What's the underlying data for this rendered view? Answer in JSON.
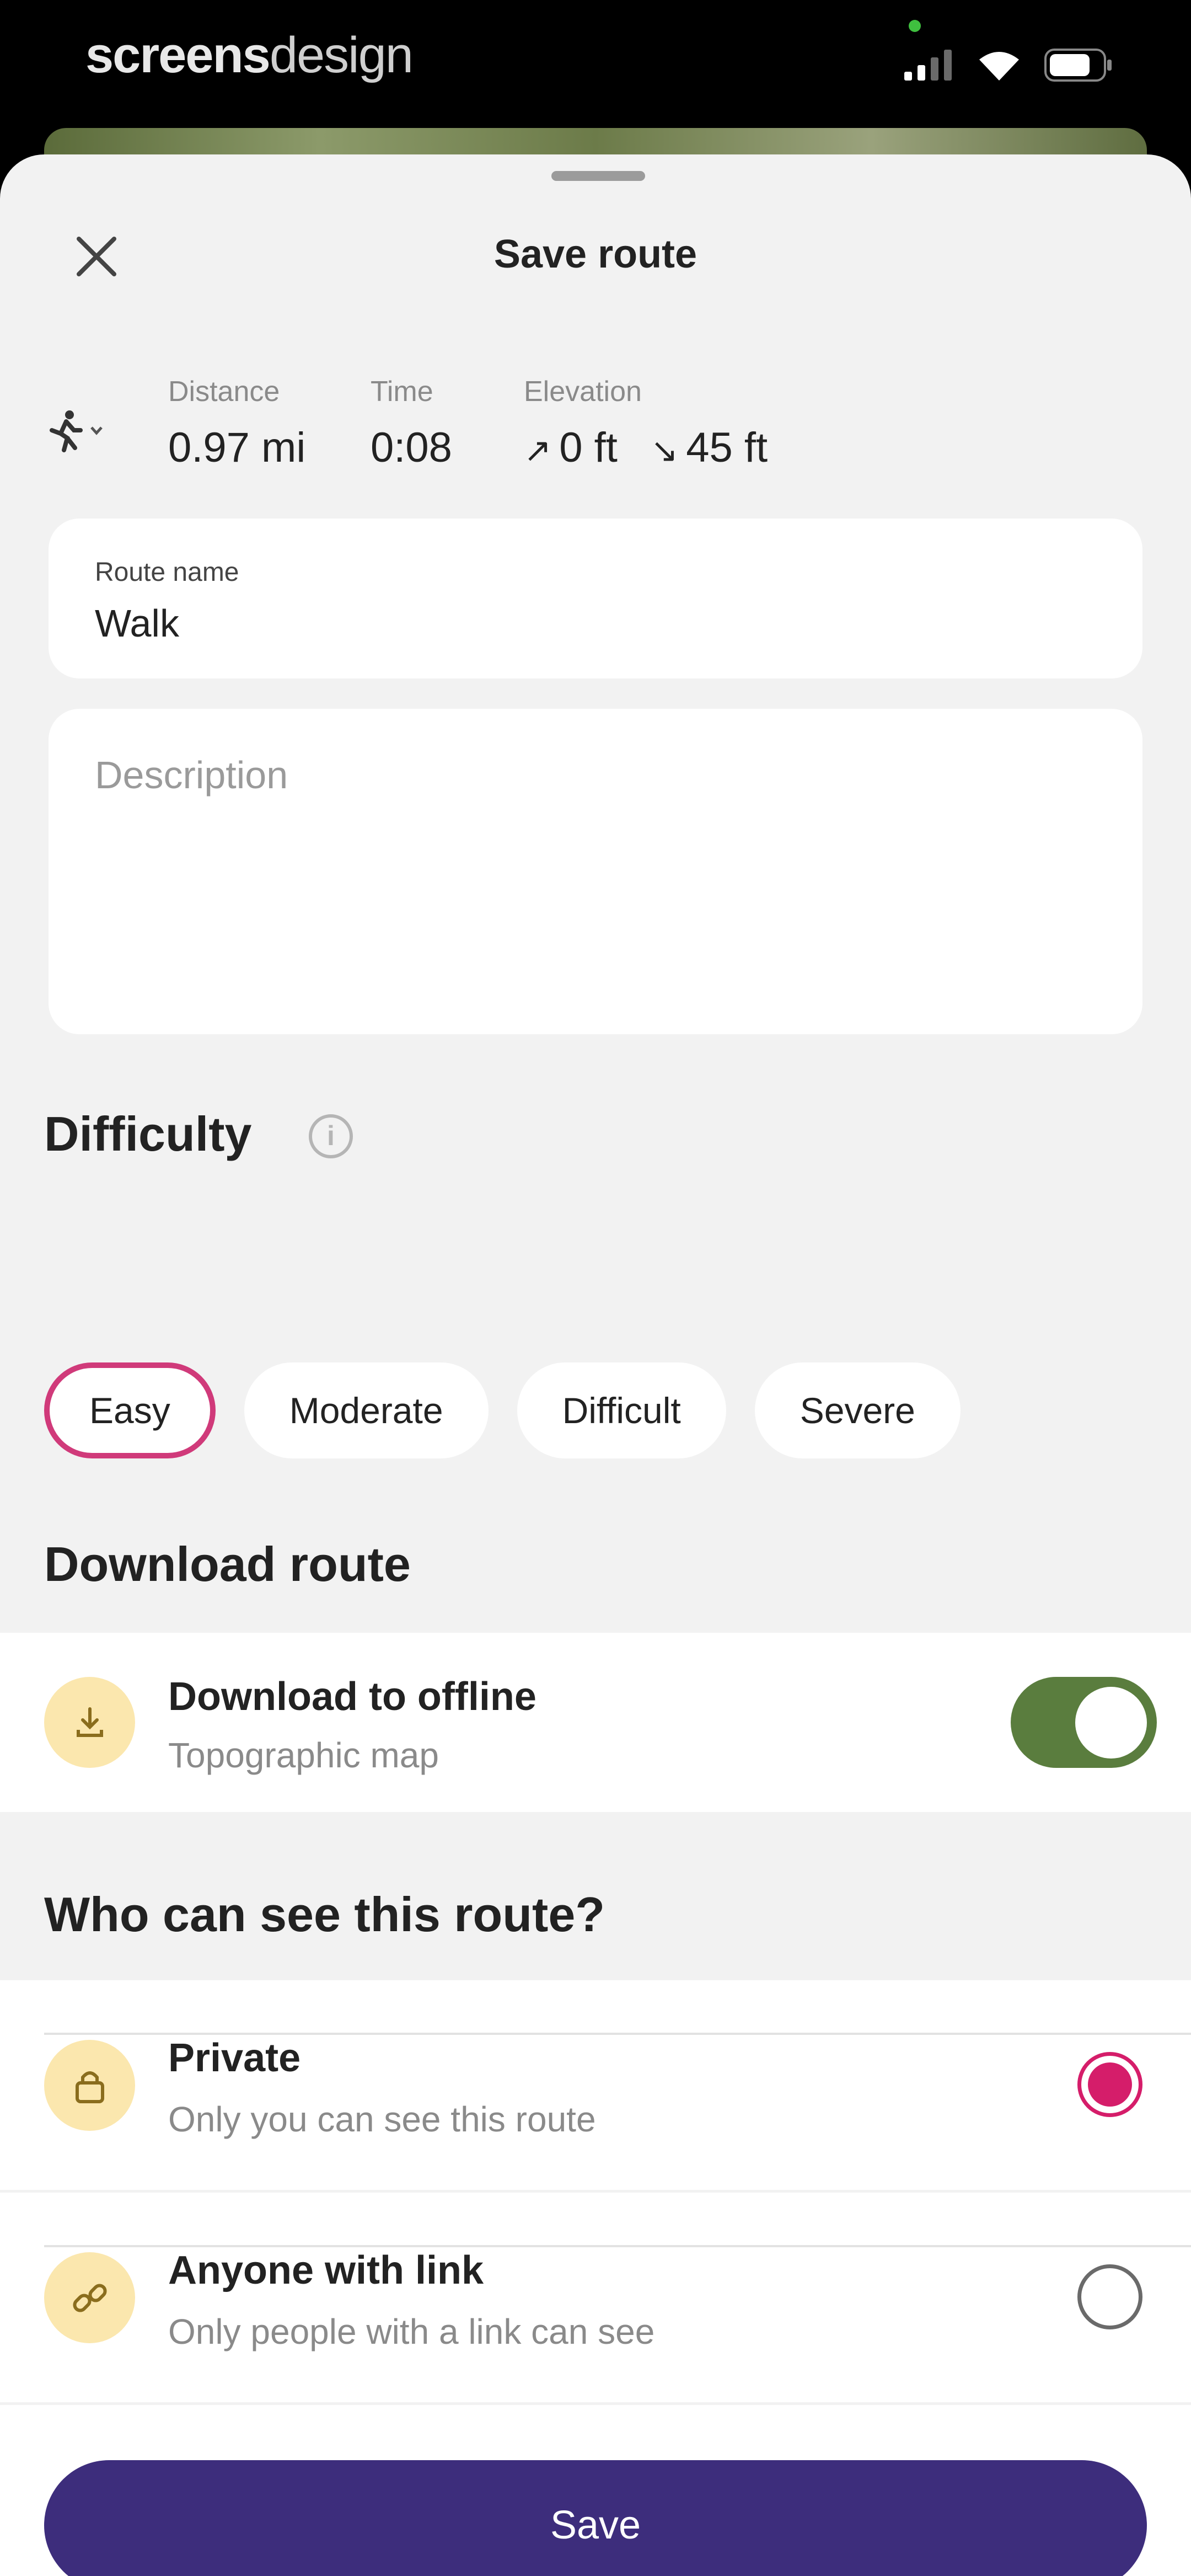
{
  "watermark": {
    "bold": "screens",
    "light": "design"
  },
  "sheet": {
    "title": "Save route"
  },
  "stats": {
    "distance": {
      "label": "Distance",
      "value": "0.97 mi"
    },
    "time": {
      "label": "Time",
      "value": "0:08"
    },
    "elevation": {
      "label": "Elevation",
      "up": "0 ft",
      "down": "45 ft"
    }
  },
  "route_name": {
    "label": "Route name",
    "value": "Walk"
  },
  "description": {
    "placeholder": "Description"
  },
  "difficulty": {
    "title": "Difficulty",
    "options": [
      "Easy",
      "Moderate",
      "Difficult",
      "Severe"
    ],
    "selected": "Easy"
  },
  "download": {
    "title": "Download route",
    "row_title": "Download to offline",
    "row_sub": "Topographic map",
    "enabled": true
  },
  "visibility": {
    "title": "Who can see this route?",
    "options": [
      {
        "title": "Private",
        "sub": "Only you can see this route",
        "selected": true
      },
      {
        "title": "Anyone with link",
        "sub": "Only people with a link can see",
        "selected": false
      }
    ]
  },
  "actions": {
    "save_label": "Save"
  },
  "colors": {
    "accent": "#3d2d7c",
    "selection": "#d51d6a",
    "toggle_on": "#5a7d3e",
    "icon_bg": "#fbe7ae"
  }
}
